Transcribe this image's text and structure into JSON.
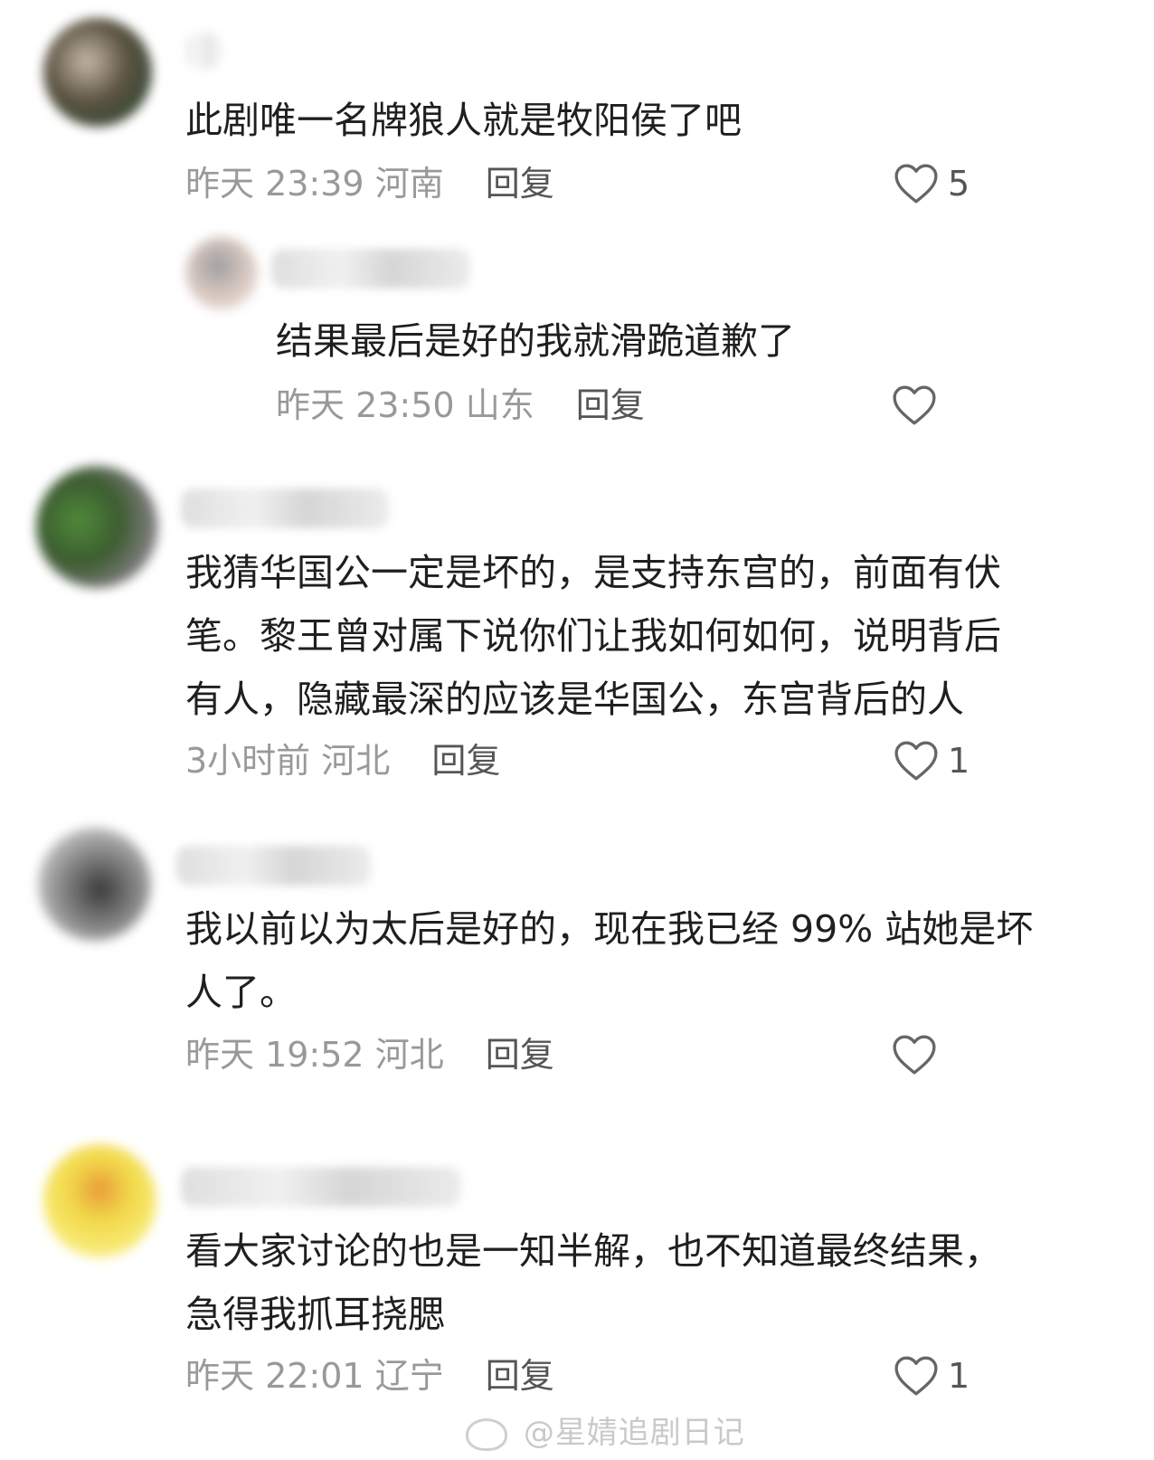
{
  "comments": [
    {
      "text": "此剧唯一名牌狼人就是牧阳侯了吧",
      "time": "昨天 23:39",
      "location": "河南",
      "reply_label": "回复",
      "likes": "5",
      "replies": [
        {
          "text": "结果最后是好的我就滑跪道歉了",
          "time": "昨天 23:50",
          "location": "山东",
          "reply_label": "回复",
          "likes": ""
        }
      ]
    },
    {
      "text": "我猜华国公一定是坏的，是支持东宫的，前面有伏\n笔。黎王曾对属下说你们让我如何如何，说明背后\n有人，隐藏最深的应该是华国公，东宫背后的人",
      "time": "3小时前",
      "location": "河北",
      "reply_label": "回复",
      "likes": "1"
    },
    {
      "text": "我以前以为太后是好的，现在我已经 99% 站她是坏\n人了。",
      "time": "昨天 19:52",
      "location": "河北",
      "reply_label": "回复",
      "likes": ""
    },
    {
      "text": "看大家讨论的也是一知半解，也不知道最终结果，\n急得我抓耳挠腮",
      "time": "昨天 22:01",
      "location": "辽宁",
      "reply_label": "回复",
      "likes": "1"
    }
  ],
  "watermark": {
    "text": "@星婧追剧日记",
    "icon": "weibo-icon"
  },
  "colors": {
    "text": "#1f1f1f",
    "meta": "#999999",
    "reply": "#555555",
    "heart": "#666666",
    "background": "#ffffff"
  }
}
